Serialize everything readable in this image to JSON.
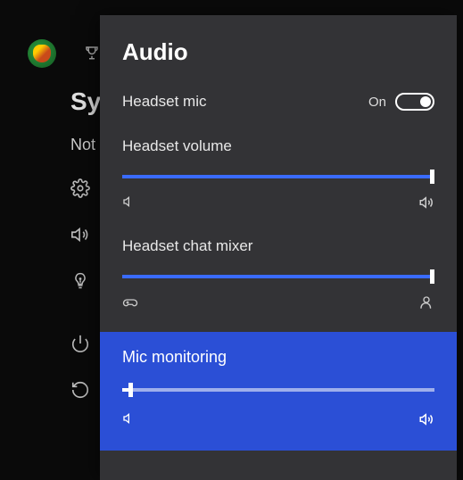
{
  "background": {
    "sys_text": "Sys",
    "not_text": "Not"
  },
  "panel": {
    "title": "Audio",
    "headset_mic": {
      "label": "Headset mic",
      "state_label": "On",
      "on": true
    },
    "headset_volume": {
      "label": "Headset volume",
      "value": 100,
      "left_icon": "speaker-low-icon",
      "right_icon": "speaker-high-icon"
    },
    "chat_mixer": {
      "label": "Headset chat mixer",
      "value": 100,
      "left_icon": "game-controller-icon",
      "right_icon": "person-icon"
    },
    "mic_monitoring": {
      "label": "Mic monitoring",
      "value": 2,
      "selected": true,
      "left_icon": "speaker-low-icon",
      "right_icon": "speaker-high-icon"
    }
  },
  "sidebar_icons": [
    "settings",
    "audio",
    "tips",
    "power",
    "restart"
  ]
}
